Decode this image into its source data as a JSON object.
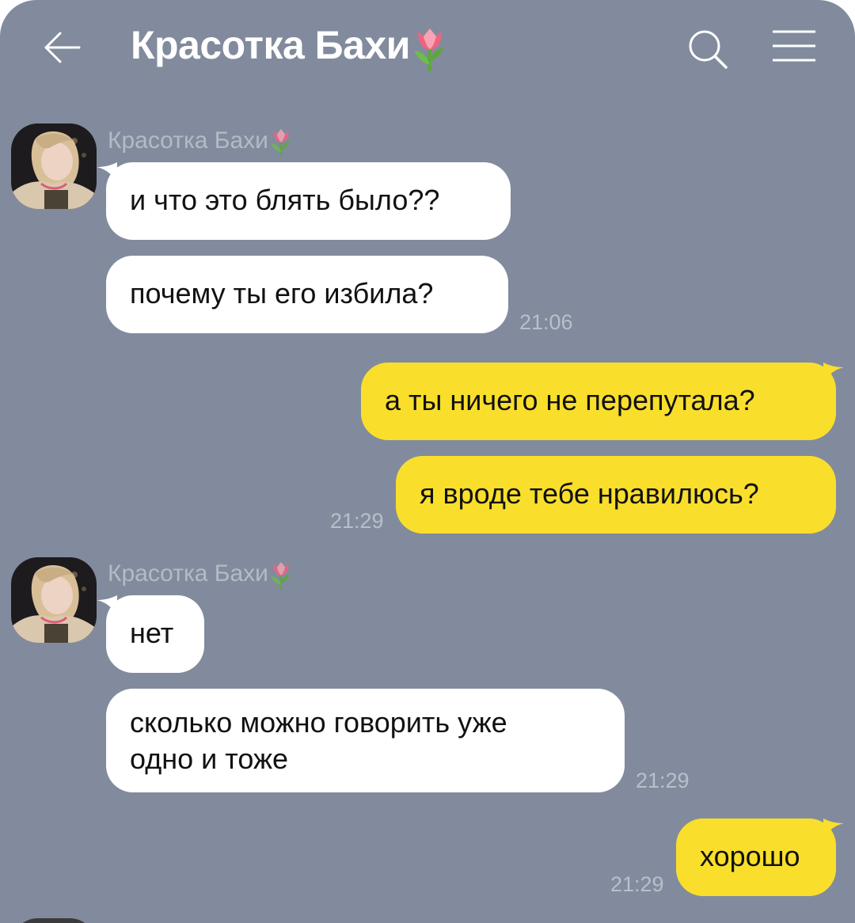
{
  "header": {
    "title": "Красотка Бахи",
    "back_icon": "arrow-left-icon",
    "search_icon": "search-icon",
    "menu_icon": "hamburger-menu-icon"
  },
  "messages": {
    "group1": {
      "sender": "Красотка Бахи",
      "bubbles": [
        "и что это блять было??",
        "почему ты его избила?"
      ],
      "time": "21:06"
    },
    "group2": {
      "bubbles": [
        "а ты ничего не перепутала?",
        "я вроде тебе нравилюсь?"
      ],
      "time": "21:29"
    },
    "group3": {
      "sender": "Красотка Бахи",
      "bubbles": [
        "нет",
        "сколько можно говорить уже",
        "одно и тоже"
      ],
      "time": "21:29"
    },
    "group4": {
      "bubbles": [
        "хорошо"
      ],
      "time": "21:29"
    }
  },
  "colors": {
    "background": "#828b9d",
    "incoming_bubble": "#ffffff",
    "outgoing_bubble": "#f9df2c",
    "timestamp": "#b9bfca"
  }
}
